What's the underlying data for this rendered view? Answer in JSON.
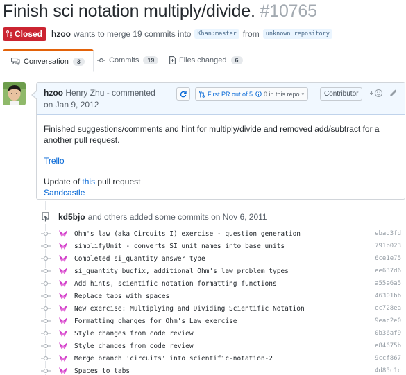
{
  "pr": {
    "title": "Finish sci notation multiply/divide.",
    "number": "#10765",
    "state_label": "Closed",
    "author": "hzoo",
    "merge_text": "wants to merge 19 commits into",
    "base_branch": "Khan:master",
    "from_text": "from",
    "head_branch": "unknown repository"
  },
  "tabs": [
    {
      "label": "Conversation",
      "count": "3"
    },
    {
      "label": "Commits",
      "count": "19"
    },
    {
      "label": "Files changed",
      "count": "6"
    }
  ],
  "comment": {
    "username": "hzoo",
    "fullname": "Henry Zhu",
    "action": "- commented",
    "date": "on Jan 9, 2012",
    "first_pr": "First PR out of 5",
    "repo_prs": "0 in this repo",
    "role": "Contributor",
    "body_text": "Finished suggestions/comments and hint for multiply/divide and removed add/subtract for a another pull request.",
    "link1": "Trello",
    "update_prefix": "Update of",
    "update_link": "this",
    "update_suffix": "pull request",
    "link2": "Sandcastle"
  },
  "push": {
    "actor": "kd5bjo",
    "text": "and others added some commits on Nov 6, 2011"
  },
  "commits": [
    {
      "message": "Ohm's law (aka Circuits I) exercise - question generation",
      "sha": "ebad3fd"
    },
    {
      "message": "simplifyUnit - converts SI unit names into base units",
      "sha": "791b023"
    },
    {
      "message": "Completed si_quantity answer type",
      "sha": "6ce1e75"
    },
    {
      "message": "si_quantity bugfix, additional Ohm's law problem types",
      "sha": "ee637d6"
    },
    {
      "message": "Add hints, scientific notation formatting functions",
      "sha": "a55e6a5"
    },
    {
      "message": "Replace tabs with spaces",
      "sha": "46301bb"
    },
    {
      "message": "New exercise: Multiplying and Dividing Scientific Notation",
      "sha": "ec728ea"
    },
    {
      "message": "Formatting changes for Ohm's Law exercise",
      "sha": "9eac2e0"
    },
    {
      "message": "Style changes from code review",
      "sha": "0b36af9"
    },
    {
      "message": "Style changes from code review",
      "sha": "e84675b"
    },
    {
      "message": "Merge branch 'circuits' into scientific-notation-2",
      "sha": "9ccf867"
    },
    {
      "message": "Spaces to tabs",
      "sha": "4d85c1c"
    }
  ],
  "colors": {
    "closed": "#cb2431",
    "link": "#0366d6",
    "tab_accent": "#e36209",
    "header_bg": "#f1f8ff"
  }
}
